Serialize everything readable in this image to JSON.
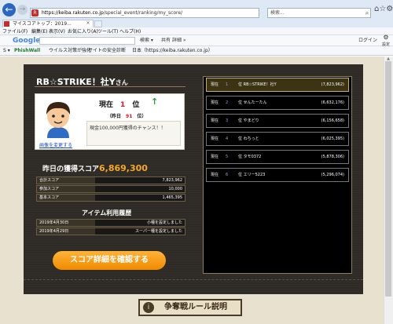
{
  "browser": {
    "url_domain": "https://keiba.rakuten.co.jp",
    "url_path": "/special_event/ranking/my_score/",
    "search_placeholder": "検索...",
    "tab_title": "マイスコアトップ：2019...",
    "tab_close": "×",
    "menu": [
      "ファイル(F)",
      "編集(E)",
      "表示(V)",
      "お気に入り(A)",
      "ツール(T)",
      "ヘルプ(H)"
    ],
    "gbar": {
      "logo": "Google",
      "search_button": "検索 ▾",
      "share": "共有",
      "more": "詳細 »",
      "login": "ログイン",
      "settings": "設定"
    },
    "toolbar": {
      "phishwall": "PhishWall",
      "virus": "ウイルス対策が強化",
      "safety": "サイトの安全診断",
      "site": "日本（https://keiba.rakuten.co.jp）"
    }
  },
  "profile": {
    "title": "RB☆STRIKE！社Y",
    "title_suffix": "さん",
    "avatar_link": "画像を変更する",
    "current_rank_prefix": "現在",
    "current_rank": "1",
    "current_rank_suffix": "位",
    "yesterday_prefix": "（昨日",
    "yesterday_rank": "91",
    "yesterday_suffix": "位）",
    "message": "現金100,000円獲得のチャンス！！"
  },
  "yesterday_score": {
    "label": "昨日の獲得スコア",
    "value": "6,869,300"
  },
  "score_rows": [
    {
      "label": "合計スコア",
      "value": "7,823,962"
    },
    {
      "label": "参加スコア",
      "value": "10,000"
    },
    {
      "label": "基本スコア",
      "value": "1,465,395"
    }
  ],
  "item_history": {
    "title": "アイテム利用履歴",
    "rows": [
      {
        "date": "2019年4月30日",
        "desc": "小種を設定しました"
      },
      {
        "date": "2019年4月29日",
        "desc": "スーパー種を設定しました"
      }
    ]
  },
  "detail_button": "スコア詳細を確認する",
  "ranking": [
    {
      "prefix": "現在",
      "rank": "1",
      "name": "位 RB☆STRIKE！社Y",
      "score": "(7,823,962)"
    },
    {
      "prefix": "現在",
      "rank": "2",
      "name": "位 せんたーたん",
      "score": "(6,632,176)"
    },
    {
      "prefix": "現在",
      "rank": "3",
      "name": "位 やまどり",
      "score": "(6,156,658)"
    },
    {
      "prefix": "現在",
      "rank": "4",
      "name": "位 わちっと",
      "score": "(6,025,395)"
    },
    {
      "prefix": "現在",
      "rank": "5",
      "name": "位 タモ0372",
      "score": "(5,878,306)"
    },
    {
      "prefix": "現在",
      "rank": "6",
      "name": "位 エリー5223",
      "score": "(5,296,074)"
    }
  ],
  "rules_button": "争奪戦ルール説明",
  "colors": {
    "accent": "#f7a823",
    "rank_red": "#d71920",
    "panel": "#2e2b26"
  }
}
